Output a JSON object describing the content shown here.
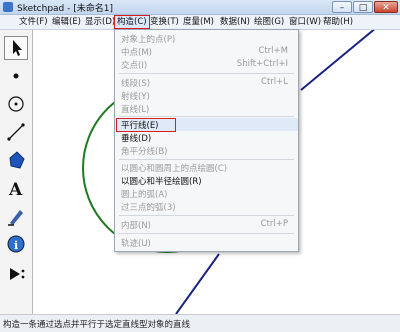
{
  "window": {
    "title": "Sketchpad - [未命名1]",
    "minimize": "–",
    "maximize": "□",
    "close": "✕"
  },
  "menubar": [
    "文件(F)",
    "编辑(E)",
    "显示(D)",
    "构造(C)",
    "变换(T)",
    "度量(M)",
    "数据(N)",
    "绘图(G)",
    "窗口(W)",
    "帮助(H)"
  ],
  "active_menu": "构造(C)",
  "construct_menu": {
    "items": [
      {
        "label": "对象上的点(P)",
        "shortcut": "",
        "enabled": false
      },
      {
        "label": "中点(M)",
        "shortcut": "Ctrl+M",
        "enabled": false
      },
      {
        "label": "交点(I)",
        "shortcut": "Shift+Ctrl+I",
        "enabled": false
      },
      {
        "label": "线段(S)",
        "shortcut": "Ctrl+L",
        "enabled": false
      },
      {
        "label": "射线(Y)",
        "shortcut": "",
        "enabled": false
      },
      {
        "label": "直线(L)",
        "shortcut": "",
        "enabled": false
      },
      {
        "label": "平行线(E)",
        "shortcut": "",
        "enabled": true,
        "highlighted": true
      },
      {
        "label": "垂线(D)",
        "shortcut": "",
        "enabled": true
      },
      {
        "label": "角平分线(B)",
        "shortcut": "",
        "enabled": false
      },
      {
        "label": "以圆心和圆周上的点绘圆(C)",
        "shortcut": "",
        "enabled": false
      },
      {
        "label": "以圆心和半径绘圆(R)",
        "shortcut": "",
        "enabled": true
      },
      {
        "label": "圆上的弧(A)",
        "shortcut": "",
        "enabled": false
      },
      {
        "label": "过三点的弧(3)",
        "shortcut": "",
        "enabled": false
      },
      {
        "label": "内部(N)",
        "shortcut": "Ctrl+P",
        "enabled": false
      },
      {
        "label": "轨迹(U)",
        "shortcut": "",
        "enabled": false
      }
    ]
  },
  "tools": [
    "arrow-tool",
    "point-tool",
    "compass-tool",
    "straightedge-tool",
    "polygon-tool",
    "text-tool",
    "marker-tool",
    "information-tool",
    "custom-tool"
  ],
  "status_text": "构造一条通过选点并平行于选定直线型对象的直线",
  "colors": {
    "circle": "#1f7a1f",
    "line": "#1a237e",
    "highlight_border": "#d32020"
  }
}
